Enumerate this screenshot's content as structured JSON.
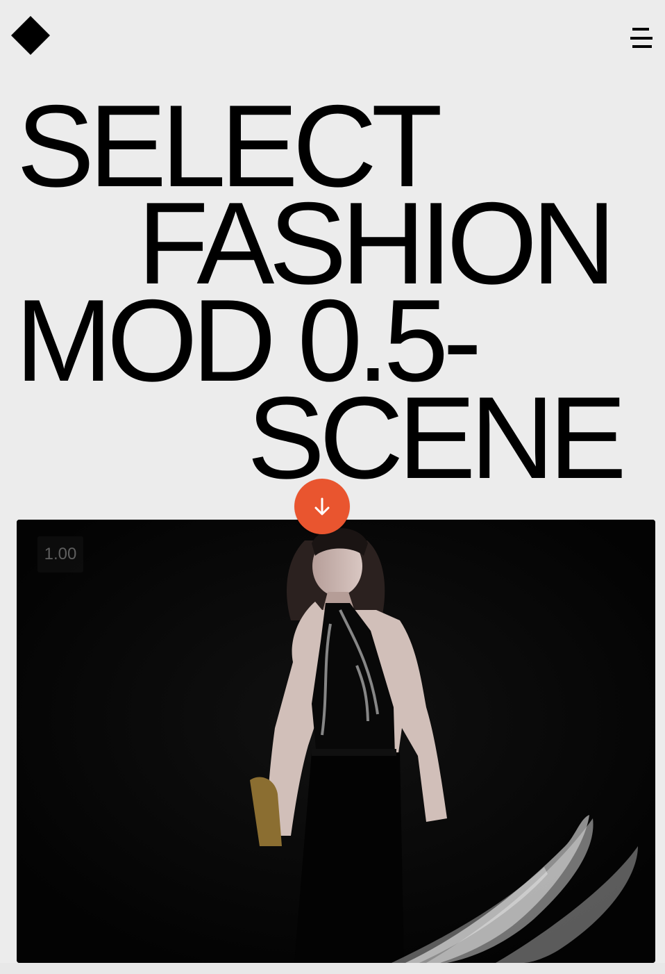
{
  "header": {
    "logo_icon": "diamond-logo-icon",
    "menu_icon": "hamburger-menu-icon"
  },
  "hero": {
    "title_lines": [
      "SELECT",
      "FASHION",
      "MOD 0.5-",
      "SCENE"
    ]
  },
  "scroll_button": {
    "icon": "arrow-down-icon",
    "color": "#e9552f"
  },
  "video": {
    "playback_speed": "1.00"
  },
  "colors": {
    "background": "#ececec",
    "text": "#000000",
    "accent": "#e9552f",
    "video_background": "#050505"
  }
}
